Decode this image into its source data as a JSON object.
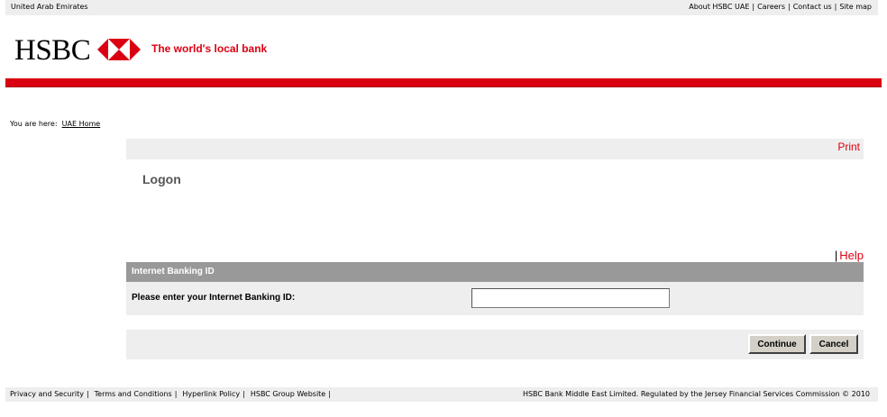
{
  "topbar": {
    "country": "United Arab Emirates",
    "links": [
      "About HSBC UAE",
      "Careers",
      "Contact us",
      "Site map"
    ],
    "separator": "|"
  },
  "header": {
    "logo_text": "HSBC",
    "tagline": "The world's local bank",
    "brand_color": "#db0011"
  },
  "breadcrumb": {
    "prefix": "You are here:",
    "link": "UAE Home"
  },
  "main": {
    "print_label": "Print",
    "title": "Logon",
    "help_pipe": "|",
    "help_label": "Help",
    "section_title": "Internet Banking ID",
    "field_label": "Please enter your Internet Banking ID:",
    "field_value": "",
    "continue_label": "Continue",
    "cancel_label": "Cancel"
  },
  "footer": {
    "links": [
      "Privacy and Security",
      "Terms and Conditions",
      "Hyperlink Policy",
      "HSBC Group Website"
    ],
    "separator": "|",
    "note": "HSBC Bank Middle East Limited. Regulated by the Jersey Financial Services Commission © 2010"
  },
  "icons": {
    "logo": "hsbc-hexagon-icon"
  }
}
